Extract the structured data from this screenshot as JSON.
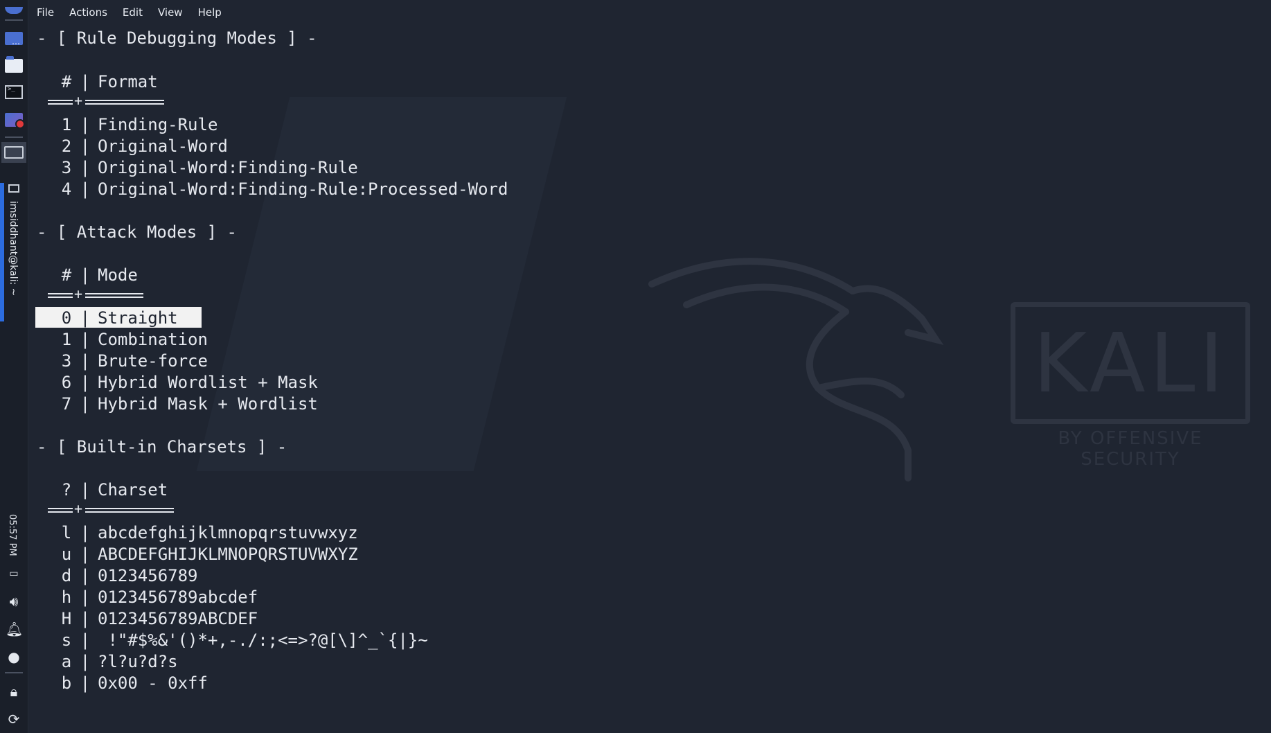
{
  "panel": {
    "task_label": "imsiddhant@kali: ~",
    "clock": "05:57 PM"
  },
  "menu": [
    "File",
    "Actions",
    "Edit",
    "View",
    "Help"
  ],
  "watermark": {
    "logo_text": "KALI",
    "sub_text": "BY OFFENSIVE SECURITY"
  },
  "sections": {
    "rule_debugging": {
      "heading": "- [ Rule Debugging Modes ] -",
      "col_num": "#",
      "col_name": "Format",
      "rows": [
        {
          "n": "1",
          "v": "Finding-Rule"
        },
        {
          "n": "2",
          "v": "Original-Word"
        },
        {
          "n": "3",
          "v": "Original-Word:Finding-Rule"
        },
        {
          "n": "4",
          "v": "Original-Word:Finding-Rule:Processed-Word"
        }
      ]
    },
    "attack_modes": {
      "heading": "- [ Attack Modes ] -",
      "col_num": "#",
      "col_name": "Mode",
      "rows": [
        {
          "n": "0",
          "v": "Straight"
        },
        {
          "n": "1",
          "v": "Combination"
        },
        {
          "n": "3",
          "v": "Brute-force"
        },
        {
          "n": "6",
          "v": "Hybrid Wordlist + Mask"
        },
        {
          "n": "7",
          "v": "Hybrid Mask + Wordlist"
        }
      ]
    },
    "charsets": {
      "heading": "- [ Built-in Charsets ] -",
      "col_num": "?",
      "col_name": "Charset",
      "rows": [
        {
          "n": "l",
          "v": "abcdefghijklmnopqrstuvwxyz"
        },
        {
          "n": "u",
          "v": "ABCDEFGHIJKLMNOPQRSTUVWXYZ"
        },
        {
          "n": "d",
          "v": "0123456789"
        },
        {
          "n": "h",
          "v": "0123456789abcdef"
        },
        {
          "n": "H",
          "v": "0123456789ABCDEF"
        },
        {
          "n": "s",
          "v": " !\"#$%&'()*+,-./:;<=>?@[\\]^_`{|}~"
        },
        {
          "n": "a",
          "v": "?l?u?d?s"
        },
        {
          "n": "b",
          "v": "0x00 - 0xff"
        }
      ]
    }
  },
  "separator_bar": "|"
}
